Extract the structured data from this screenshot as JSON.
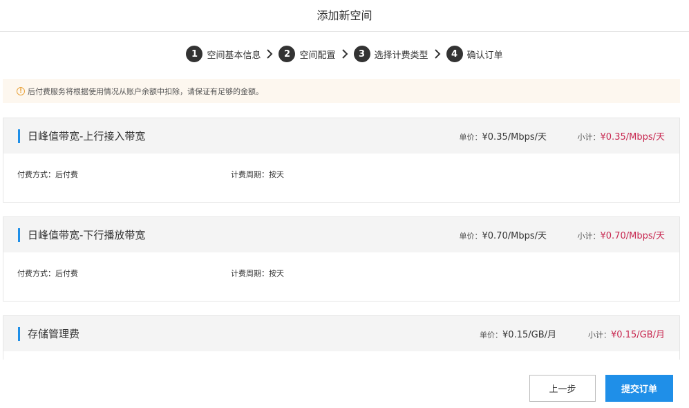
{
  "header": {
    "title": "添加新空间"
  },
  "steps": [
    {
      "num": "1",
      "label": "空间基本信息"
    },
    {
      "num": "2",
      "label": "空间配置"
    },
    {
      "num": "3",
      "label": "选择计费类型"
    },
    {
      "num": "4",
      "label": "确认订单"
    }
  ],
  "notice": {
    "text": "后付费服务将根据使用情况从账户余额中扣除，请保证有足够的金额。"
  },
  "cards": [
    {
      "title": "日峰值带宽-上行接入带宽",
      "price_label": "单价：",
      "price_value": "¥0.35/Mbps/天",
      "subtotal_label": "小计：",
      "subtotal_value": "¥0.35/Mbps/天",
      "pay_method": "付费方式：后付费",
      "billing_cycle": "计费周期：按天"
    },
    {
      "title": "日峰值带宽-下行播放带宽",
      "price_label": "单价：",
      "price_value": "¥0.70/Mbps/天",
      "subtotal_label": "小计：",
      "subtotal_value": "¥0.70/Mbps/天",
      "pay_method": "付费方式：后付费",
      "billing_cycle": "计费周期：按天"
    },
    {
      "title": "存储管理费",
      "price_label": "单价：",
      "price_value": "¥0.15/GB/月",
      "subtotal_label": "小计：",
      "subtotal_value": "¥0.15/GB/月"
    }
  ],
  "footer": {
    "prev_label": "上一步",
    "submit_label": "提交订单"
  },
  "colors": {
    "accent": "#1f8fe8",
    "price_red": "#c7254e",
    "notice_bg": "#fdf7ef",
    "warning": "#e8a33d"
  }
}
